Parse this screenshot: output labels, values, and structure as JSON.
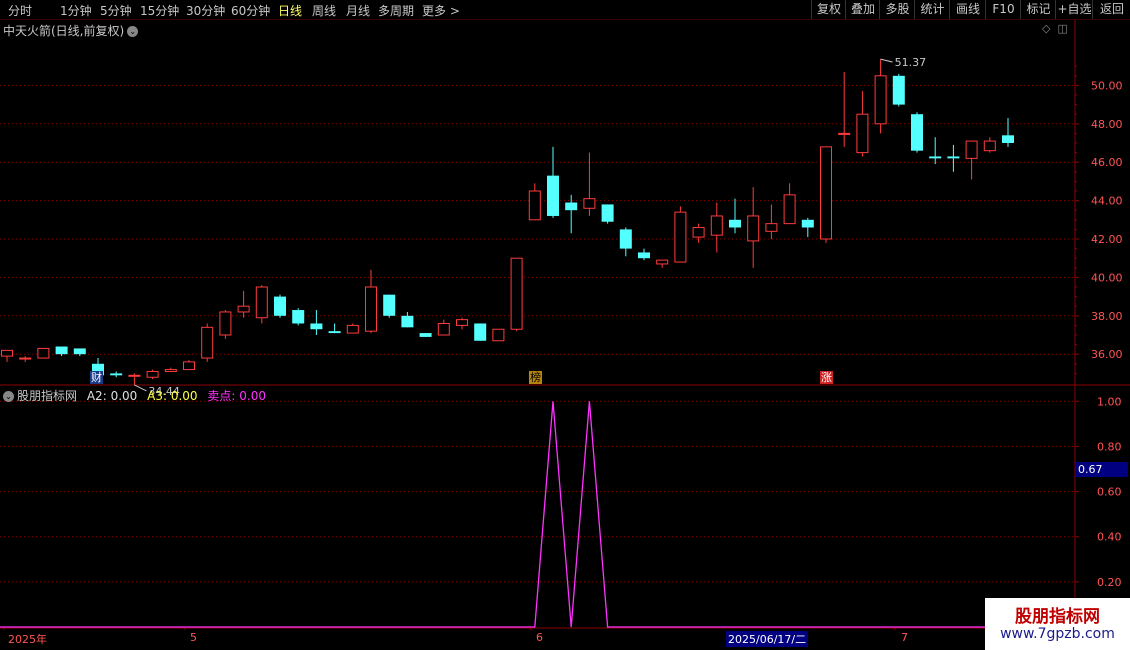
{
  "toolbar": {
    "items": [
      "分时",
      "1分钟",
      "5分钟",
      "15分钟",
      "30分钟",
      "60分钟",
      "日线",
      "周线",
      "月线",
      "多周期",
      "更多 >"
    ],
    "active": "日线",
    "right_items": [
      "复权",
      "叠加",
      "多股",
      "统计",
      "画线",
      "F10",
      "标记",
      "+自选",
      "返回"
    ]
  },
  "main_chart": {
    "title": "中天火箭(日线,前复权)",
    "high_label": "51.37",
    "low_label": "34.44",
    "tags": [
      "财",
      "榜",
      "涨"
    ],
    "y_ticks": [
      "50.00",
      "48.00",
      "46.00",
      "44.00",
      "42.00",
      "40.00",
      "38.00",
      "36.00"
    ]
  },
  "indicator": {
    "name": "股朋指标网",
    "a2_label": "A2:",
    "a2_value": "0.00",
    "a3_label": "A3:",
    "a3_value": "0.00",
    "sell_label": "卖点:",
    "sell_value": "0.00",
    "y_ticks": [
      "1.00",
      "0.80",
      "0.60",
      "0.40",
      "0.20"
    ],
    "cursor_value": "0.67"
  },
  "x_axis": {
    "labels": [
      "2025年",
      "5",
      "6",
      "7"
    ],
    "cursor_date": "2025/06/17/二"
  },
  "watermark": {
    "title": "股朋指标网",
    "url": "www.7gpzb.com"
  },
  "colors": {
    "up": "#ff3b3b",
    "down": "#54ffff",
    "sell_line": "#ff33ff",
    "grid": "#8b0000"
  },
  "chart_data": [
    {
      "type": "candlestick",
      "title": "中天火箭(日线,前复权)",
      "ylim": [
        34.5,
        52
      ],
      "y_ticks": [
        50,
        48,
        46,
        44,
        42,
        40,
        38,
        36
      ],
      "candles": [
        [
          35.9,
          36.2,
          35.6,
          35.9
        ],
        [
          35.8,
          35.8,
          35.6,
          35.9
        ],
        [
          35.8,
          36.3,
          35.8,
          36.2
        ],
        [
          36.4,
          36.0,
          35.9,
          36.4
        ],
        [
          36.3,
          36.0,
          35.9,
          36.3
        ],
        [
          35.5,
          34.9,
          34.6,
          35.8
        ],
        [
          35.0,
          34.9,
          34.8,
          35.1
        ],
        [
          34.9,
          34.9,
          34.4,
          35.0
        ],
        [
          34.8,
          35.1,
          34.7,
          35.2
        ],
        [
          35.1,
          35.2,
          35.1,
          35.3
        ],
        [
          35.2,
          35.6,
          35.2,
          35.7
        ],
        [
          35.8,
          37.4,
          35.6,
          37.6
        ],
        [
          37.0,
          38.2,
          36.8,
          38.3
        ],
        [
          38.2,
          38.5,
          37.9,
          39.3
        ],
        [
          37.9,
          39.5,
          37.6,
          39.6
        ],
        [
          39.0,
          38.0,
          37.9,
          39.1
        ],
        [
          38.3,
          37.6,
          37.5,
          38.4
        ],
        [
          37.6,
          37.3,
          37.0,
          38.3
        ],
        [
          37.2,
          37.1,
          37.1,
          37.6
        ],
        [
          37.1,
          37.5,
          37.2,
          37.6
        ],
        [
          37.2,
          39.5,
          37.1,
          40.4
        ],
        [
          39.1,
          38.0,
          37.9,
          39.1
        ],
        [
          38.0,
          37.4,
          37.4,
          38.2
        ],
        [
          37.1,
          36.9,
          36.9,
          37.1
        ],
        [
          37.0,
          37.6,
          37.0,
          37.8
        ],
        [
          37.5,
          37.8,
          37.3,
          37.9
        ],
        [
          37.6,
          36.7,
          36.7,
          37.6
        ],
        [
          36.7,
          37.3,
          36.7,
          37.3
        ],
        [
          37.3,
          41.0,
          37.2,
          41.0
        ],
        [
          43.0,
          44.5,
          43.0,
          44.9
        ],
        [
          45.3,
          43.2,
          43.1,
          46.8
        ],
        [
          43.9,
          43.5,
          42.3,
          44.3
        ],
        [
          43.6,
          44.1,
          43.2,
          46.5
        ],
        [
          43.8,
          42.9,
          42.8,
          43.8
        ],
        [
          42.5,
          41.5,
          41.1,
          42.6
        ],
        [
          41.3,
          41.0,
          40.9,
          41.5
        ],
        [
          40.7,
          40.9,
          40.5,
          40.9
        ],
        [
          40.8,
          43.4,
          40.8,
          43.7
        ],
        [
          42.1,
          42.6,
          41.8,
          42.8
        ],
        [
          42.2,
          43.2,
          41.3,
          43.9
        ],
        [
          43.0,
          42.6,
          42.3,
          44.1
        ],
        [
          41.9,
          43.2,
          40.5,
          44.7
        ],
        [
          42.4,
          42.8,
          42.0,
          43.8
        ],
        [
          42.8,
          44.3,
          42.8,
          44.9
        ],
        [
          43.0,
          42.6,
          42.1,
          43.1
        ],
        [
          42.0,
          46.8,
          41.8,
          46.8
        ],
        [
          47.5,
          47.5,
          46.8,
          50.7
        ],
        [
          46.5,
          48.5,
          46.3,
          49.7
        ],
        [
          48.0,
          50.5,
          47.5,
          51.37
        ],
        [
          50.5,
          49.0,
          48.9,
          50.6
        ],
        [
          48.5,
          46.6,
          46.5,
          48.6
        ],
        [
          46.3,
          46.2,
          45.9,
          47.3
        ],
        [
          46.3,
          46.2,
          45.5,
          46.9
        ],
        [
          46.2,
          47.1,
          45.1,
          47.1
        ],
        [
          46.6,
          47.1,
          46.5,
          47.3
        ],
        [
          47.4,
          47.0,
          46.8,
          48.3
        ]
      ]
    },
    {
      "type": "line",
      "title": "股朋指标网",
      "ylim": [
        0,
        1.05
      ],
      "y_ticks": [
        1.0,
        0.8,
        0.6,
        0.4,
        0.2
      ],
      "series": [
        {
          "name": "卖点",
          "values": [
            0,
            0,
            0,
            0,
            0,
            0,
            0,
            0,
            0,
            0,
            0,
            0,
            0,
            0,
            0,
            0,
            0,
            0,
            0,
            0,
            0,
            0,
            0,
            0,
            0,
            0,
            0,
            0,
            0,
            0,
            1,
            0,
            1,
            0,
            0,
            0,
            0,
            0,
            0,
            0,
            0,
            0,
            0,
            0,
            0,
            0,
            0,
            0,
            0,
            0,
            0,
            0,
            0,
            0,
            0,
            0
          ]
        }
      ]
    }
  ]
}
